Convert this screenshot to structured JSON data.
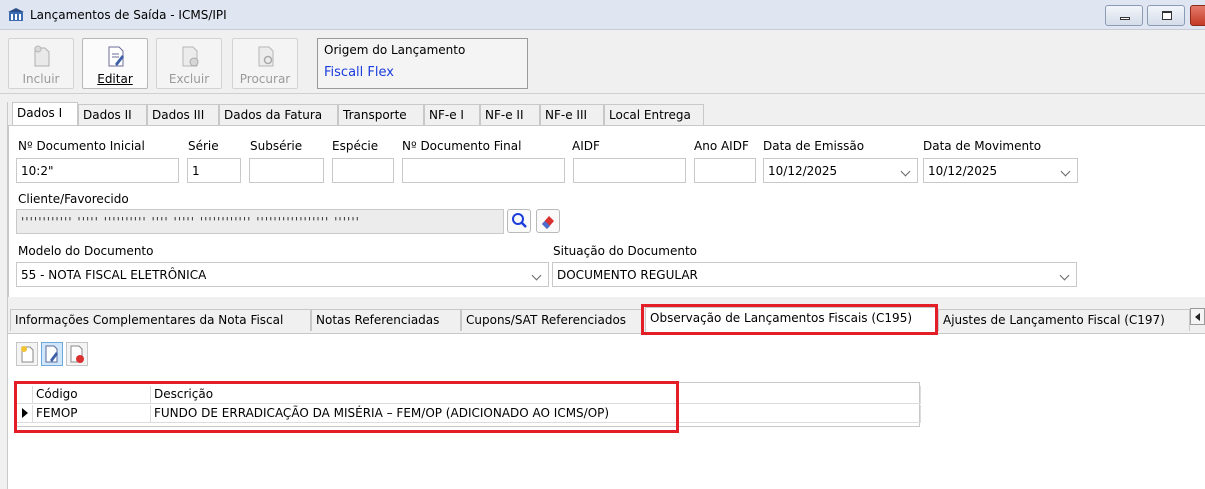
{
  "window": {
    "title": "Lançamentos de Saída - ICMS/IPI"
  },
  "toolbar": {
    "incluir": "Incluir",
    "editar": "Editar",
    "excluir": "Excluir",
    "procurar": "Procurar",
    "origin_caption": "Origem do Lançamento",
    "origin_value": "Fiscall Flex"
  },
  "top_tabs": [
    "Dados I",
    "Dados II",
    "Dados III",
    "Dados da Fatura",
    "Transporte",
    "NF-e I",
    "NF-e II",
    "NF-e III",
    "Local Entrega"
  ],
  "form": {
    "doc_inicial_label": "Nº Documento Inicial",
    "doc_inicial_value": "10:2\"",
    "serie_label": "Série",
    "serie_value": "1",
    "subserie_label": "Subsérie",
    "subserie_value": "",
    "especie_label": "Espécie",
    "especie_value": "",
    "doc_final_label": "Nº Documento Final",
    "doc_final_value": "",
    "aidf_label": "AIDF",
    "aidf_value": "",
    "ano_aidf_label": "Ano AIDF",
    "ano_aidf_value": "",
    "data_emissao_label": "Data de Emissão",
    "data_emissao_value": "10/12/2025",
    "data_movimento_label": "Data de Movimento",
    "data_movimento_value": "10/12/2025",
    "cliente_label": "Cliente/Favorecido",
    "cliente_value": "'''''''''''' ''''' '''''''''' '''' ''''' '''''''''''' ''''''''''''''''' ''''''",
    "modelo_label": "Modelo do Documento",
    "modelo_value": "55 - NOTA FISCAL ELETRÔNICA",
    "situacao_label": "Situação do Documento",
    "situacao_value": "DOCUMENTO REGULAR"
  },
  "bottom_tabs": [
    "Informações Complementares da Nota Fiscal",
    "Notas Referenciadas",
    "Cupons/SAT Referenciados",
    "Observação de Lançamentos Fiscais (C195)",
    "Ajustes de Lançamento Fiscal (C197)"
  ],
  "grid": {
    "columns": [
      "Código",
      "Descrição"
    ],
    "rows": [
      {
        "codigo": "FEMOP",
        "descricao": "FUNDO DE ERRADICAÇÃO DA MISÉRIA – FEM/OP (ADICIONADO AO ICMS/OP)"
      }
    ]
  },
  "colors": {
    "highlight": "#e41e26",
    "origin_value": "#1a3cdc"
  }
}
